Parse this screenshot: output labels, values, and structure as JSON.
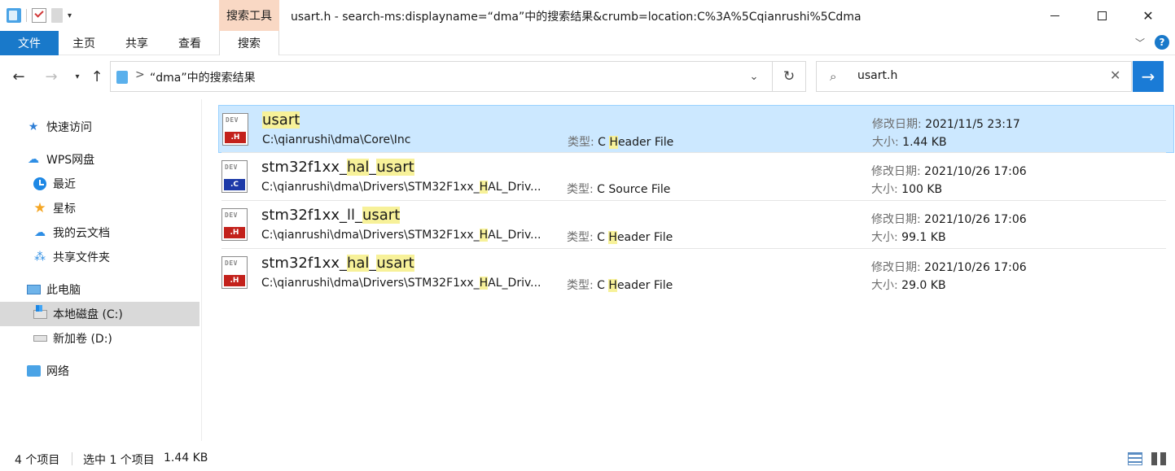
{
  "window": {
    "title": "usart.h - search-ms:displayname=“dma”中的搜索结果&crumb=location:C%3A%5Cqianrushi%5Cdma",
    "context_tab_group": "搜索工具",
    "controls": {
      "minimize": "—",
      "maximize": "□",
      "close": "✕"
    }
  },
  "ribbon": {
    "tabs": [
      {
        "label": "文件"
      },
      {
        "label": "主页"
      },
      {
        "label": "共享"
      },
      {
        "label": "查看"
      },
      {
        "label": "搜索"
      }
    ],
    "help": "?"
  },
  "address": {
    "breadcrumb": "“dma”中的搜索结果",
    "separator": ">"
  },
  "search": {
    "value": "usart.h",
    "go": "→"
  },
  "nav_pane": [
    {
      "label": "快速访问",
      "icon": "quick-access-icon"
    },
    {
      "label": "WPS网盘",
      "icon": "cloud-icon"
    },
    {
      "label": "最近",
      "icon": "clock-icon"
    },
    {
      "label": "星标",
      "icon": "star-icon"
    },
    {
      "label": "我的云文档",
      "icon": "cloud-doc-icon"
    },
    {
      "label": "共享文件夹",
      "icon": "shared-folder-icon"
    },
    {
      "label": "此电脑",
      "icon": "pc-icon"
    },
    {
      "label": "本地磁盘 (C:)",
      "icon": "drive-c-icon",
      "selected": true
    },
    {
      "label": "新加卷 (D:)",
      "icon": "drive-d-icon"
    },
    {
      "label": "网络",
      "icon": "network-icon"
    }
  ],
  "results": [
    {
      "name_parts": [
        {
          "t": "usart",
          "hl": true
        }
      ],
      "path_parts": [
        {
          "t": "C:\\qianrushi\\dma\\Core\\Inc",
          "hl": false
        }
      ],
      "type_label": "类型:",
      "type_parts": [
        {
          "t": "C ",
          "hl": false
        },
        {
          "t": "H",
          "hl": true
        },
        {
          "t": "eader File",
          "hl": false
        }
      ],
      "date_label": "修改日期:",
      "date": "2021/11/5 23:17",
      "size_label": "大小:",
      "size": "1.44 KB",
      "badge": ".H",
      "selected": true
    },
    {
      "name_parts": [
        {
          "t": "stm32f1xx",
          "hl": false
        },
        {
          "t": "_",
          "hl": false
        },
        {
          "t": "hal",
          "hl": true
        },
        {
          "t": "_",
          "hl": false
        },
        {
          "t": "usart",
          "hl": true
        }
      ],
      "path_parts": [
        {
          "t": "C:\\qianrushi\\dma\\Drivers\\STM32F1xx",
          "hl": false
        },
        {
          "t": "_",
          "hl": false
        },
        {
          "t": "H",
          "hl": true
        },
        {
          "t": "AL_Driv...",
          "hl": false
        }
      ],
      "type_label": "类型:",
      "type_parts": [
        {
          "t": "C Source File",
          "hl": false
        }
      ],
      "date_label": "修改日期:",
      "date": "2021/10/26 17:06",
      "size_label": "大小:",
      "size": "100 KB",
      "badge": ".C",
      "selected": false
    },
    {
      "name_parts": [
        {
          "t": "stm32f1xx_ll",
          "hl": false
        },
        {
          "t": "_",
          "hl": false
        },
        {
          "t": "usart",
          "hl": true
        }
      ],
      "path_parts": [
        {
          "t": "C:\\qianrushi\\dma\\Drivers\\STM32F1xx",
          "hl": false
        },
        {
          "t": "_",
          "hl": false
        },
        {
          "t": "H",
          "hl": true
        },
        {
          "t": "AL_Driv...",
          "hl": false
        }
      ],
      "type_label": "类型:",
      "type_parts": [
        {
          "t": "C ",
          "hl": false
        },
        {
          "t": "H",
          "hl": true
        },
        {
          "t": "eader File",
          "hl": false
        }
      ],
      "date_label": "修改日期:",
      "date": "2021/10/26 17:06",
      "size_label": "大小:",
      "size": "99.1 KB",
      "badge": ".H",
      "selected": false
    },
    {
      "name_parts": [
        {
          "t": "stm32f1xx",
          "hl": false
        },
        {
          "t": "_",
          "hl": false
        },
        {
          "t": "hal",
          "hl": true
        },
        {
          "t": "_",
          "hl": false
        },
        {
          "t": "usart",
          "hl": true
        }
      ],
      "path_parts": [
        {
          "t": "C:\\qianrushi\\dma\\Drivers\\STM32F1xx",
          "hl": false
        },
        {
          "t": "_",
          "hl": false
        },
        {
          "t": "H",
          "hl": true
        },
        {
          "t": "AL_Driv...",
          "hl": false
        }
      ],
      "type_label": "类型:",
      "type_parts": [
        {
          "t": "C ",
          "hl": false
        },
        {
          "t": "H",
          "hl": true
        },
        {
          "t": "eader File",
          "hl": false
        }
      ],
      "date_label": "修改日期:",
      "date": "2021/10/26 17:06",
      "size_label": "大小:",
      "size": "29.0 KB",
      "badge": ".H",
      "selected": false
    }
  ],
  "file_icon_text": "DEV",
  "status": {
    "count": "4 个项目",
    "selection": "选中 1 个项目",
    "selection_size": "1.44 KB"
  },
  "colors": {
    "accent": "#1979ca",
    "selection_bg": "#cce8ff",
    "highlight": "#f7f199",
    "context_tab": "#f9d8c4"
  }
}
